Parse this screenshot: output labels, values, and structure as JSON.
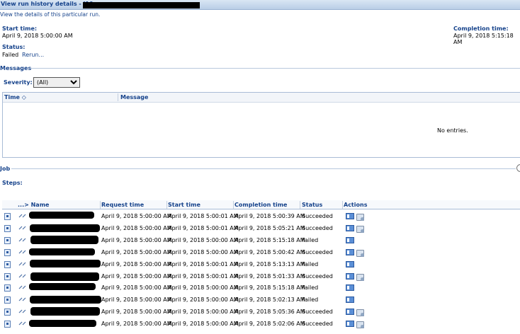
{
  "header": {
    "title": "View run history details - J10",
    "subtitle": "View the details of this particular run."
  },
  "run": {
    "start_label": "Start time:",
    "start_value": "April 9, 2018 5:00:00 AM",
    "completion_label": "Completion time:",
    "completion_value": "April 9, 2018 5:15:18 AM",
    "status_label": "Status:",
    "status_value": "Failed",
    "rerun_label": "Rerun..."
  },
  "messages": {
    "section_title": "Messages",
    "severity_label": "Severity:",
    "severity_value": "(All)",
    "col_time": "Time",
    "col_message": "Message",
    "empty_text": "No entries."
  },
  "job": {
    "section_title": "Job",
    "steps_label": "Steps:"
  },
  "steps_table": {
    "columns": [
      "...> Name",
      "Request time",
      "Start time",
      "Completion time",
      "Status",
      "Actions"
    ],
    "rows": [
      {
        "request": "April 9, 2018 5:00:00 AM",
        "start": "April 9, 2018 5:00:01 AM",
        "completion": "April 9, 2018 5:00:39 AM",
        "status": "Succeeded"
      },
      {
        "request": "April 9, 2018 5:00:00 AM",
        "start": "April 9, 2018 5:00:01 AM",
        "completion": "April 9, 2018 5:05:21 AM",
        "status": "Succeeded"
      },
      {
        "request": "April 9, 2018 5:00:00 AM",
        "start": "April 9, 2018 5:00:00 AM",
        "completion": "April 9, 2018 5:15:18 AM",
        "status": "Failed"
      },
      {
        "request": "April 9, 2018 5:00:00 AM",
        "start": "April 9, 2018 5:00:00 AM",
        "completion": "April 9, 2018 5:00:42 AM",
        "status": "Succeeded"
      },
      {
        "request": "April 9, 2018 5:00:00 AM",
        "start": "April 9, 2018 5:00:01 AM",
        "completion": "April 9, 2018 5:13:13 AM",
        "status": "Failed"
      },
      {
        "request": "April 9, 2018 5:00:00 AM",
        "start": "April 9, 2018 5:00:01 AM",
        "completion": "April 9, 2018 5:01:33 AM",
        "status": "Succeeded"
      },
      {
        "request": "April 9, 2018 5:00:00 AM",
        "start": "April 9, 2018 5:00:00 AM",
        "completion": "April 9, 2018 5:15:18 AM",
        "status": "Failed"
      },
      {
        "request": "April 9, 2018 5:00:00 AM",
        "start": "April 9, 2018 5:00:00 AM",
        "completion": "April 9, 2018 5:02:13 AM",
        "status": "Failed"
      },
      {
        "request": "April 9, 2018 5:00:00 AM",
        "start": "April 9, 2018 5:00:00 AM",
        "completion": "April 9, 2018 5:05:36 AM",
        "status": "Succeeded"
      },
      {
        "request": "April 9, 2018 5:00:00 AM",
        "start": "April 9, 2018 5:00:00 AM",
        "completion": "April 9, 2018 5:02:06 AM",
        "status": "Succeeded"
      }
    ]
  }
}
